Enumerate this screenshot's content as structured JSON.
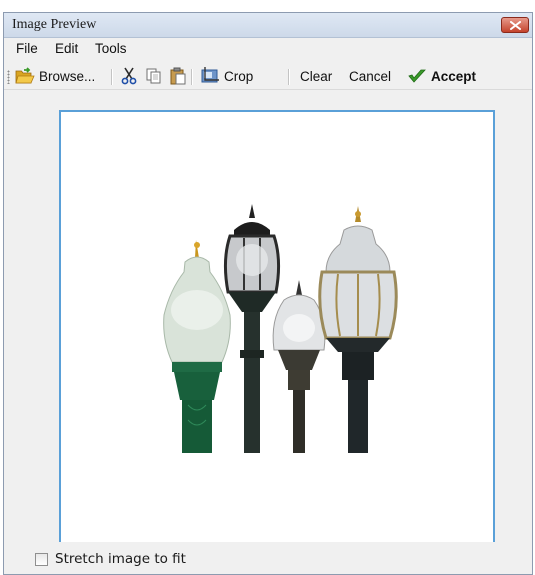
{
  "window": {
    "title": "Image Preview"
  },
  "menu": {
    "items": [
      "File",
      "Edit",
      "Tools"
    ]
  },
  "toolbar": {
    "browse_label": "Browse...",
    "crop_label": "Crop",
    "clear_label": "Clear",
    "cancel_label": "Cancel",
    "accept_label": "Accept",
    "icons": [
      "folder-open-icon",
      "cut-icon",
      "copy-icon",
      "paste-icon",
      "crop-icon",
      "checkmark-icon"
    ]
  },
  "preview": {
    "frame_color": "#5aa0d8",
    "image_subject": "street lamps"
  },
  "options": {
    "stretch_label": "Stretch image to fit",
    "stretch_checked": false
  },
  "colors": {
    "accept_check": "#3a9a2a",
    "close_button": "#c4432c"
  }
}
